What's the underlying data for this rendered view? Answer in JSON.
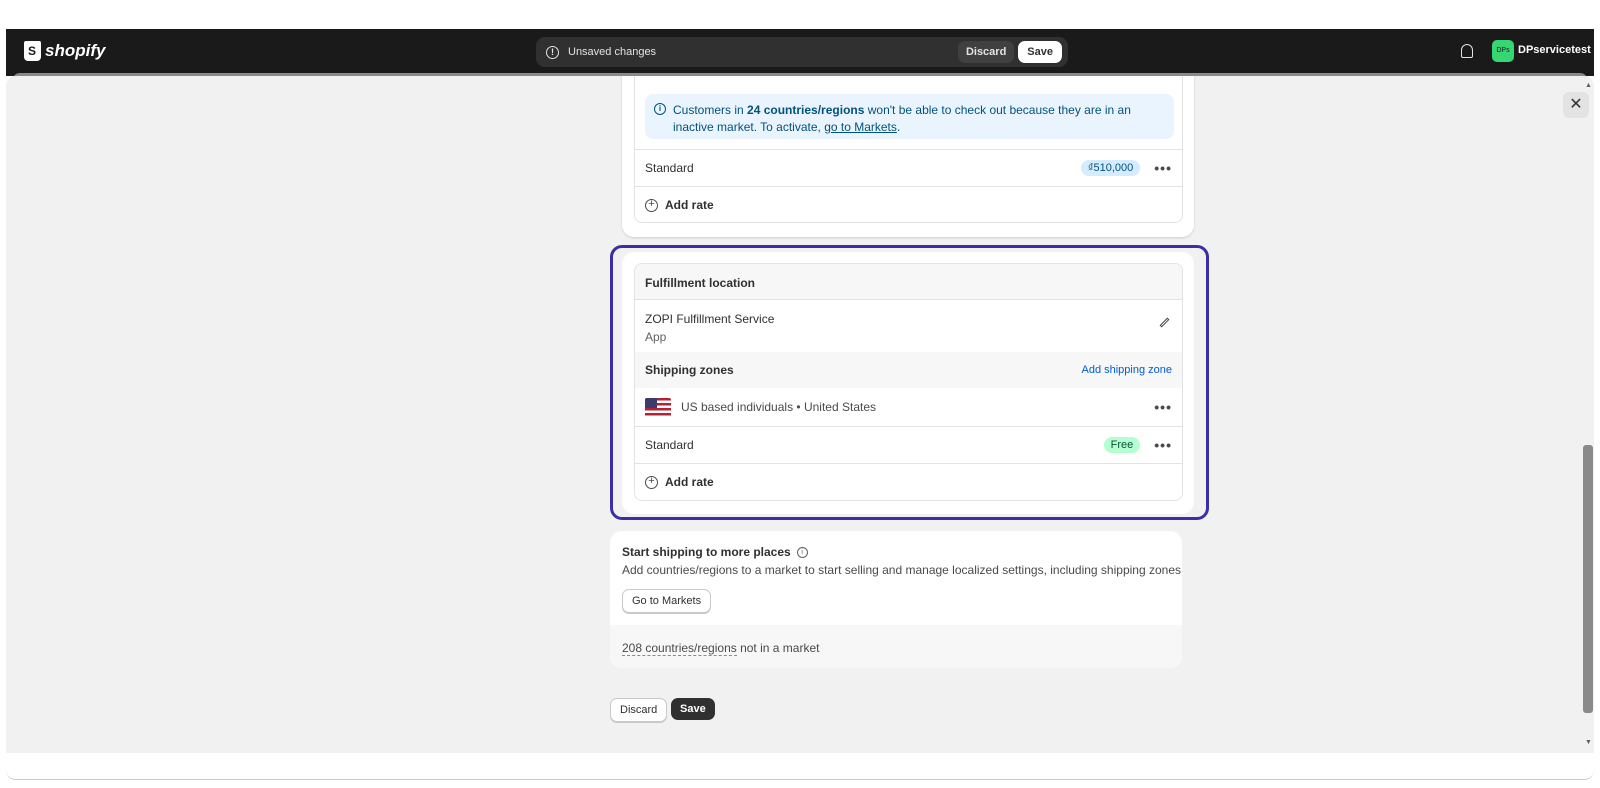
{
  "topbar": {
    "brand": "shopify",
    "unsaved": {
      "message": "Unsaved changes",
      "discard": "Discard",
      "save": "Save"
    },
    "avatar_initials": "DPs",
    "store_name": "DPservicetest"
  },
  "modal": {
    "close": "✕",
    "upper_zone": {
      "banner": {
        "prefix": "Customers in ",
        "bold": "24 countries/regions",
        "middle": " won't be able to check out because they are in an inactive market. To activate, ",
        "link": "go to Markets",
        "suffix": "."
      },
      "rate": {
        "name": "Standard",
        "price": "₫510,000"
      },
      "add_rate": "Add rate"
    },
    "fulfillment": {
      "header": "Fulfillment location",
      "location_name": "ZOPI Fulfillment Service",
      "location_type": "App",
      "zones_title": "Shipping zones",
      "add_zone": "Add shipping zone",
      "zone": {
        "name": "US based individuals",
        "separator": " • ",
        "country": "United States"
      },
      "rate": {
        "name": "Standard",
        "price": "Free"
      },
      "add_rate": "Add rate"
    },
    "start_shipping": {
      "title": "Start shipping to more places",
      "description": "Add countries/regions to a market to start selling and manage localized settings, including shipping zones",
      "button": "Go to Markets",
      "footer_link": "208 countries/regions",
      "footer_text": " not in a market"
    },
    "footer": {
      "discard": "Discard",
      "save": "Save"
    }
  },
  "colors": {
    "topbar": "#1a1a1a",
    "highlight": "#3b2fa8",
    "link": "#005bd3",
    "banner": "#eaf4ff",
    "free_badge": "#b4fed2"
  }
}
